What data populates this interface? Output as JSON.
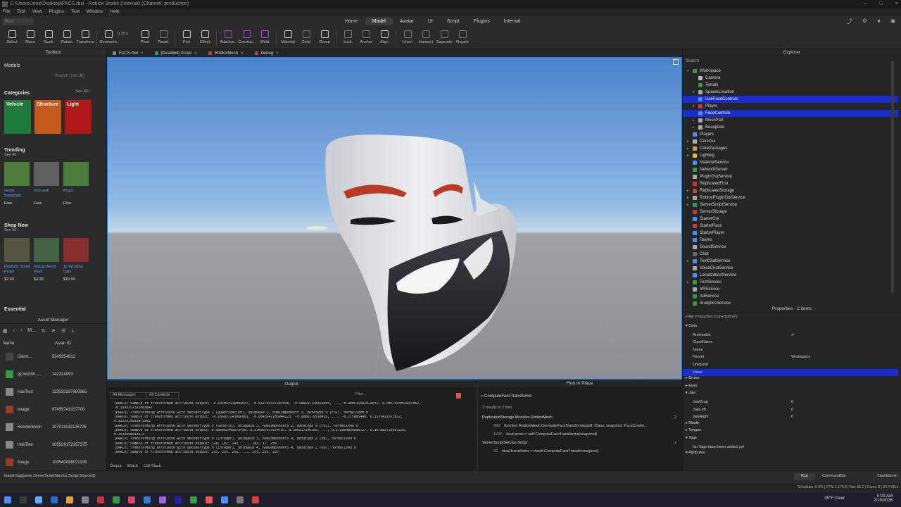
{
  "window": {
    "title": "C:\\Users\\Jone\\Desktop\\FACS.rbxl - Roblox Studio (Internal) (Channel: production)"
  },
  "menu": [
    "File",
    "Edit",
    "View",
    "Plugins",
    "Test",
    "Window",
    "Help"
  ],
  "ribbon": {
    "tabs": [
      "Home",
      "Model",
      "Avatar",
      "UI",
      "Script",
      "Plugins",
      "Internal"
    ],
    "active_tab": "Model",
    "left_box": "Run"
  },
  "toolbar": {
    "tools": [
      {
        "label": "Select",
        "color": "#cccccc"
      },
      {
        "label": "Move",
        "color": "#cccccc"
      },
      {
        "label": "Scale",
        "color": "#cccccc"
      },
      {
        "label": "Rotate",
        "color": "#cccccc"
      },
      {
        "label": "Transform",
        "color": "#cccccc"
      },
      {
        "label": "Geometric",
        "color": "#cccccc"
      },
      {
        "label": "Pivot",
        "color": "#cccccc"
      },
      {
        "label": "Reset",
        "color": "#777777"
      },
      {
        "label": "Part",
        "color": "#cccccc"
      },
      {
        "label": "Effect",
        "color": "#cccccc"
      },
      {
        "label": "Attachm..",
        "color": "#b040e0"
      },
      {
        "label": "Constrai..",
        "color": "#b040e0"
      },
      {
        "label": "Weld",
        "color": "#b040e0"
      },
      {
        "label": "Material",
        "color": "#cccccc"
      },
      {
        "label": "Color",
        "color": "#777777"
      },
      {
        "label": "Group",
        "color": "#cccccc"
      },
      {
        "label": "Lock",
        "color": "#777777"
      },
      {
        "label": "Anchor",
        "color": "#777777"
      },
      {
        "label": "Align",
        "color": "#cccccc"
      },
      {
        "label": "Union",
        "color": "#777777"
      },
      {
        "label": "Intersect",
        "color": "#777777"
      },
      {
        "label": "Separate",
        "color": "#777777"
      },
      {
        "label": "Negate",
        "color": "#777777"
      }
    ],
    "step_value": "0.25 s"
  },
  "toolbox": {
    "title": "Toolbox",
    "tab_models": "Models",
    "search_placeholder": "Search (use ⌘)",
    "categories_heading": "Categories",
    "see_all": "See All ›",
    "categories": [
      {
        "label": "Vehicle",
        "color": "#1e7a3a"
      },
      {
        "label": "Structure",
        "color": "#c55a1a"
      },
      {
        "label": "Light",
        "color": "#b01818"
      }
    ],
    "trending_heading": "Trending",
    "see_all_small": "See All ›",
    "trending": [
      {
        "name": "Grass Baseplate",
        "price": "Free"
      },
      {
        "name": "rock wall",
        "price": "Free"
      },
      {
        "name": "Map2",
        "price": "Free"
      }
    ],
    "shop_heading": "Shop New",
    "shop": [
      {
        "name": "Realistic Street Props",
        "price": "$2.99"
      },
      {
        "name": "Nature Asset Pack",
        "price": "$4.99"
      },
      {
        "name": "10 Working Cars",
        "price": "$15.99"
      }
    ],
    "essential_heading": "Essential"
  },
  "asset_manager": {
    "title": "Asset Manager",
    "filter_label": "M...",
    "col_name": "Name",
    "col_id": "Asset ID",
    "rows": [
      {
        "name": "Client...",
        "id": "5345954812",
        "color": "#444444"
      },
      {
        "name": "qCmdUtil -...",
        "id": "142314093",
        "color": "#2ea043"
      },
      {
        "name": "HairTest",
        "id": "113533197650965",
        "color": "#888888"
      },
      {
        "name": "Image",
        "id": "87459741037700",
        "color": "#9a3a2a"
      },
      {
        "name": "RenderMesh",
        "id": "107011142125725",
        "color": "#888888"
      },
      {
        "name": "HairTest",
        "id": "105529172357375",
        "color": "#888888"
      },
      {
        "name": "Image",
        "id": "100540086021106",
        "color": "#9a3a2a"
      }
    ]
  },
  "doc_tabs": [
    {
      "label": "FACS.rbxl",
      "color": "#888888"
    },
    {
      "label": "[Disabled] Script",
      "color": "#2ea043"
    },
    {
      "label": "RobloxMesh",
      "color": "#c33b3b"
    },
    {
      "label": "Debug",
      "color": "#c33b3b"
    }
  ],
  "output": {
    "title": "Output",
    "filter_messages": "All Messages",
    "filter_contexts": "All Contexts",
    "filter_placeholder": "Filter...",
    "lines": [
      "[DRACO] Sample of transformed attribute output: -0.105043136084537, -0.432765337292936, -0.508261138329465, ..., 0.480415502029071, 0.0857594554497062,",
      "-0.3183357315068047",
      "[DRACO] Transforming attribute with decoderType 2 (Quantization), uniqueId 1, numComponents 3, datatype 9 (F32), normalized 0",
      "[DRACO] Sample of transformed attribute output: -0.166837243866001, -0.0043647286944223, -0.0888179518428, ..., -0.275665448, 0.5576411673812,",
      "0.9323329815873862",
      "[DRACO] Transforming attribute with decoderType 0 (Generic), uniqueId 3, numComponents 2, datatype 9 (F32), normalized 0",
      "[DRACO] Sample of transformed attribute output: 0.586883442673456, 0.514567973974787, 0.586317346785, ..., 0.272854859896727, 0.957882732855152,",
      "0.2533998814611",
      "[DRACO] Transforming attribute with decoderType 0 (Integer), uniqueId 3, numComponents 4, datatype 2 (U8), normalized 0",
      "[DRACO] Sample of transformed attribute output: 128, 142, 142, ..., 183, 17, 254",
      "[DRACO] Transforming attribute with decoderType 0 (Integer), uniqueId 4, numComponents 4, datatype 2 (U8), normalized 0",
      "[DRACO] Sample of transformed attribute output: 255, 255, 255, ..., 255, 255, 255"
    ],
    "tabs": [
      "Output",
      "Watch",
      "Call Stack"
    ]
  },
  "find": {
    "title": "Find In Place",
    "query": "ComputeFacsTransforms",
    "summary": "3 results in 2 files",
    "results": [
      {
        "file": "ReplicatedStorage.Modules.RobloxMesh",
        "count": "2",
        "lines": [
          {
            "ln": "990",
            "text": "function RobloxMesh:ComputeFacsTransforms(self: Class, snapshot: FaceContro..."
          },
          {
            "ln": "1232",
            "text": "local pose = self:ComputeFacsTransforms(snapshot)"
          }
        ]
      },
      {
        "file": "ServerScriptService.Script",
        "count": "1",
        "lines": [
          {
            "ln": "82",
            "text": "local transforms = mesh:ComputeFacsTransforms(pose)"
          }
        ]
      }
    ]
  },
  "explorer": {
    "title": "Explorer",
    "search_placeholder": "Search",
    "rows": [
      {
        "label": "Workspace",
        "depth": 0,
        "arrow": "▾",
        "color": "#2ea043",
        "sel": false
      },
      {
        "label": "Camera",
        "depth": 1,
        "arrow": "",
        "color": "#bbbbbb",
        "sel": false
      },
      {
        "label": "Terrain",
        "depth": 1,
        "arrow": "",
        "color": "#2ea043",
        "sel": false
      },
      {
        "label": "SpawnLocation",
        "depth": 1,
        "arrow": "▸",
        "color": "#aaaaaa",
        "sel": false
      },
      {
        "label": "UseFaceControls",
        "depth": 1,
        "arrow": "",
        "color": "#4a8cff",
        "sel": true
      },
      {
        "label": "Player",
        "depth": 1,
        "arrow": "▾",
        "color": "#c33b3b",
        "sel": false
      },
      {
        "label": "FaceControls",
        "depth": 1,
        "arrow": "",
        "color": "#4a8cff",
        "sel": true
      },
      {
        "label": "MeshPart",
        "depth": 1,
        "arrow": "▸",
        "color": "#aaaaaa",
        "sel": false
      },
      {
        "label": "Baseplate",
        "depth": 1,
        "arrow": "▸",
        "color": "#aaaaaa",
        "sel": false
      },
      {
        "label": "Players",
        "depth": 0,
        "arrow": "",
        "color": "#4a8cff",
        "sel": false
      },
      {
        "label": "CoreGui",
        "depth": 0,
        "arrow": "▸",
        "color": "#aaaaaa",
        "sel": false
      },
      {
        "label": "CorePackages",
        "depth": 0,
        "arrow": "▸",
        "color": "#c8a040",
        "sel": false
      },
      {
        "label": "Lighting",
        "depth": 0,
        "arrow": "▸",
        "color": "#e0c030",
        "sel": false
      },
      {
        "label": "MaterialService",
        "depth": 0,
        "arrow": "",
        "color": "#4a8cff",
        "sel": false
      },
      {
        "label": "NetworkServer",
        "depth": 0,
        "arrow": "",
        "color": "#2ea043",
        "sel": false
      },
      {
        "label": "PluginGuiService",
        "depth": 0,
        "arrow": "",
        "color": "#aaaaaa",
        "sel": false
      },
      {
        "label": "ReplicatedFirst",
        "depth": 0,
        "arrow": "",
        "color": "#c33b3b",
        "sel": false
      },
      {
        "label": "ReplicatedStorage",
        "depth": 0,
        "arrow": "▸",
        "color": "#c33b3b",
        "sel": false
      },
      {
        "label": "RobloxPluginGuiService",
        "depth": 0,
        "arrow": "▸",
        "color": "#aaaaaa",
        "sel": false
      },
      {
        "label": "ServerScriptService",
        "depth": 0,
        "arrow": "▸",
        "color": "#2ea043",
        "sel": false
      },
      {
        "label": "ServerStorage",
        "depth": 0,
        "arrow": "",
        "color": "#c33b3b",
        "sel": false
      },
      {
        "label": "StarterGui",
        "depth": 0,
        "arrow": "",
        "color": "#4a8cff",
        "sel": false
      },
      {
        "label": "StarterPack",
        "depth": 0,
        "arrow": "",
        "color": "#c33b3b",
        "sel": false
      },
      {
        "label": "StarterPlayer",
        "depth": 0,
        "arrow": "",
        "color": "#4a8cff",
        "sel": false
      },
      {
        "label": "Teams",
        "depth": 0,
        "arrow": "",
        "color": "#4a8cff",
        "sel": false
      },
      {
        "label": "SoundService",
        "depth": 0,
        "arrow": "",
        "color": "#aaaaaa",
        "sel": false
      },
      {
        "label": "Chat",
        "depth": 0,
        "arrow": "",
        "color": "#666666",
        "sel": false
      },
      {
        "label": "TextChatService",
        "depth": 0,
        "arrow": "▸",
        "color": "#4a8cff",
        "sel": false
      },
      {
        "label": "VoiceChatService",
        "depth": 0,
        "arrow": "",
        "color": "#aaaaaa",
        "sel": false
      },
      {
        "label": "LocalizationService",
        "depth": 0,
        "arrow": "",
        "color": "#4a8cff",
        "sel": false
      },
      {
        "label": "TestService",
        "depth": 0,
        "arrow": "▸",
        "color": "#2ea043",
        "sel": false
      },
      {
        "label": "VRService",
        "depth": 0,
        "arrow": "",
        "color": "#aaaaaa",
        "sel": false
      },
      {
        "label": "AdService",
        "depth": 0,
        "arrow": "",
        "color": "#2ea043",
        "sel": false
      },
      {
        "label": "AnalyticsService",
        "depth": 0,
        "arrow": "",
        "color": "#2ea043",
        "sel": false
      }
    ]
  },
  "properties": {
    "title": "Properties - 2 items",
    "filter_placeholder": "Filter Properties (Ctrl+Shift+P)",
    "rows": [
      {
        "type": "cat",
        "label": "▾ Data"
      },
      {
        "type": "prop",
        "label": "Archivable",
        "value": "✔"
      },
      {
        "type": "prop",
        "label": "ClassName",
        "value": ""
      },
      {
        "type": "prop",
        "label": "Name",
        "value": ""
      },
      {
        "type": "prop",
        "label": "Parent",
        "value": "Workspace"
      },
      {
        "type": "prop",
        "label": "UniqueId",
        "value": ""
      },
      {
        "type": "sel",
        "label": "Value",
        "value": ""
      },
      {
        "type": "cat",
        "label": "▸ Brows"
      },
      {
        "type": "cat",
        "label": "▸ Eyes"
      },
      {
        "type": "cat",
        "label": "▾ Jaw"
      },
      {
        "type": "prop",
        "label": "JawDrop",
        "value": "0"
      },
      {
        "type": "prop",
        "label": "JawLeft",
        "value": "0"
      },
      {
        "type": "prop",
        "label": "JawRight",
        "value": "0"
      },
      {
        "type": "cat",
        "label": "▸ Mouth"
      },
      {
        "type": "cat",
        "label": "▸ Tongue"
      },
      {
        "type": "cat",
        "label": "▾ Tags"
      },
      {
        "type": "prop",
        "label": "No Tags have been added yet",
        "value": ""
      },
      {
        "type": "cat",
        "label": "▾ Attributes"
      }
    ]
  },
  "statusbar": {
    "command_path": "loadstring(game.ServerScriptService.Script.Source)()",
    "run_label": "Run",
    "command_bar": "CommandBar",
    "mode": "Standalone",
    "stats": "Scheduler: 0.0% | FPS: 1,178.3 | Net: 80.2 | Cores: 8 | 29.4 KB/s"
  },
  "taskbar": {
    "weather": "35°F Clear",
    "time": "5:03 AM",
    "date": "2/10/2026"
  }
}
